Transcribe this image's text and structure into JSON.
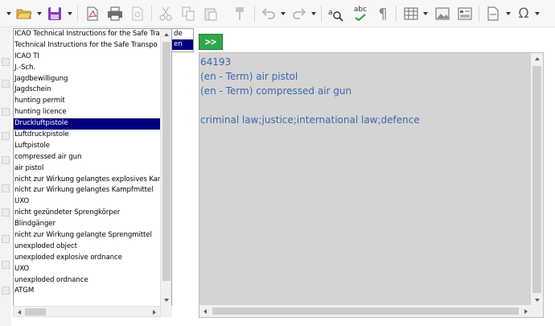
{
  "toolbar": {
    "icons": [
      "open-folder-icon",
      "save-icon",
      "export-pdf-icon",
      "print-icon",
      "print-preview-icon",
      "cut-icon",
      "copy-icon",
      "paste-icon",
      "clone-formatting-icon",
      "undo-icon",
      "redo-icon",
      "find-replace-icon",
      "spellcheck-icon",
      "formatting-marks-icon",
      "insert-table-icon",
      "insert-image-icon",
      "insert-chart-icon",
      "page-break-icon",
      "special-character-icon"
    ],
    "spellcheck_label": "abc",
    "omega_label": "Ω",
    "pilcrow_label": "¶"
  },
  "term_list": {
    "items": [
      "ICAO Technical Instructions for the Safe Tra",
      "Technical Instructions for the Safe Transpo",
      "ICAO TI",
      "J.-Sch.",
      "Jagdbewilligung",
      "Jagdschein",
      "hunting permit",
      "hunting licence",
      "Druckluftpistole",
      "Luftdruckpistole",
      "Luftpistole",
      "compressed air gun",
      "air pistol",
      "nicht zur Wirkung gelangtes explosives Kar",
      "nicht zur Wirkung gelangtes Kampfmittel",
      "UXO",
      "nicht gezündeter Sprengkörper",
      "Blindgänger",
      "nicht zur Wirkung gelangte Sprengmittel",
      "unexploded object",
      "unexploded explosive ordnance",
      "UXO",
      "unexploded ordnance",
      "ATGM"
    ],
    "selected_index": 8
  },
  "language_list": {
    "items": [
      "de",
      "en"
    ],
    "selected_index": 1
  },
  "translate_button": {
    "label": ">>"
  },
  "result": {
    "lines": [
      "64193",
      "(en - Term) air pistol",
      "(en - Term) compressed air gun",
      "",
      "criminal law;justice;international law;defence"
    ]
  },
  "colors": {
    "selection": "#000080",
    "result_text": "#3a67a8",
    "result_bg": "#d4d4d4",
    "button_green": "#2ea84a"
  }
}
